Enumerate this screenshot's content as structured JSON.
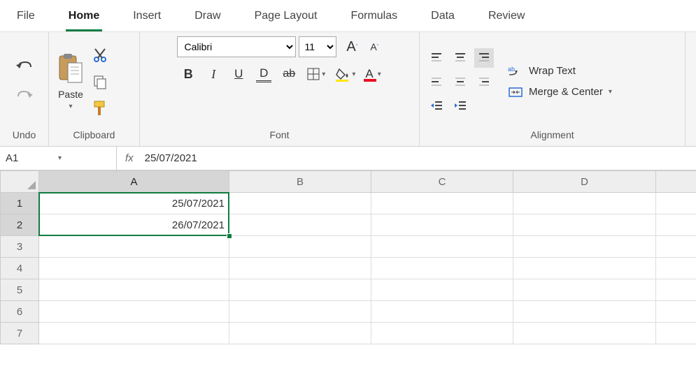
{
  "tabs": [
    "File",
    "Home",
    "Insert",
    "Draw",
    "Page Layout",
    "Formulas",
    "Data",
    "Review"
  ],
  "active_tab": "Home",
  "ribbon": {
    "undo_label": "Undo",
    "clipboard_label": "Clipboard",
    "paste_label": "Paste",
    "font_label": "Font",
    "alignment_label": "Alignment",
    "font_name": "Calibri",
    "font_size": "11",
    "wrap_text": "Wrap Text",
    "merge_center": "Merge & Center"
  },
  "name_box": "A1",
  "formula_value": "25/07/2021",
  "columns": [
    "A",
    "B",
    "C",
    "D"
  ],
  "rows": [
    "1",
    "2",
    "3",
    "4",
    "5",
    "6",
    "7"
  ],
  "cells": {
    "A1": "25/07/2021",
    "A2": "26/07/2021"
  },
  "selected_rows": [
    0,
    1
  ],
  "selected_col": 0
}
